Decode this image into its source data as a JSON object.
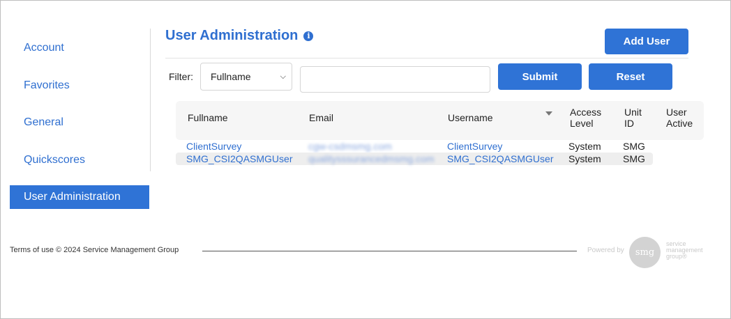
{
  "sidebar": {
    "items": [
      {
        "label": "Account"
      },
      {
        "label": "Favorites"
      },
      {
        "label": "General"
      },
      {
        "label": "Quickscores"
      },
      {
        "label": "User Administration",
        "active": true
      }
    ]
  },
  "header": {
    "title": "User Administration",
    "info_glyph": "i",
    "add_user_label": "Add User"
  },
  "filter": {
    "label": "Filter:",
    "selected": "Fullname",
    "input_value": "",
    "submit_label": "Submit",
    "reset_label": "Reset"
  },
  "table": {
    "columns": [
      {
        "label": "Fullname"
      },
      {
        "label": "Email"
      },
      {
        "label": "Username"
      },
      {
        "label_line1": "Access",
        "label_line2": "Level"
      },
      {
        "label_line1": "Unit",
        "label_line2": "ID"
      },
      {
        "label_line1": "User",
        "label_line2": "Active"
      }
    ],
    "rows": [
      {
        "fullname": "ClientSurvey",
        "email": "cgw-csdmsmg.com",
        "username": "ClientSurvey",
        "access_level": "System",
        "unit_id": "SMG",
        "user_active": ""
      },
      {
        "fullname": "SMG_CSI2QASMGUser",
        "email": "qualitysssurancedmsmg.com",
        "username": "SMG_CSI2QASMGUser",
        "access_level": "System",
        "unit_id": "SMG",
        "user_active": ""
      }
    ]
  },
  "footer": {
    "terms": "Terms of use © 2024 Service Management Group",
    "powered_by": "Powered by",
    "logo_mark": "smg",
    "logo_line1": "service",
    "logo_line2": "management",
    "logo_line3": "group®"
  },
  "colors": {
    "accent": "#2f73d6",
    "link": "#2f6fd0"
  }
}
